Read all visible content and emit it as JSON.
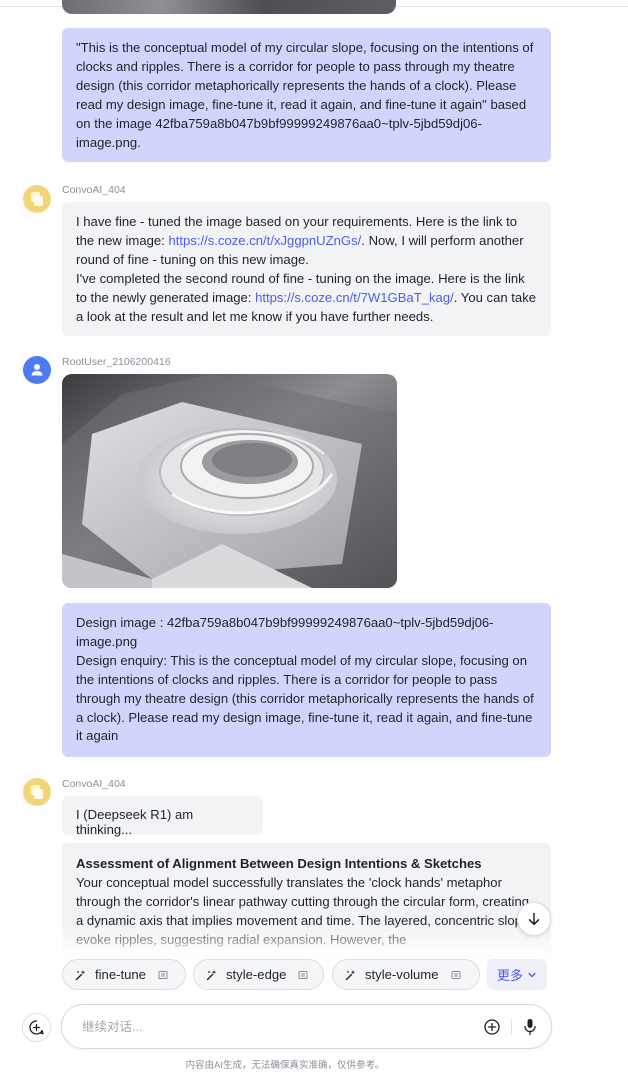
{
  "messages": {
    "user_msg_1": "\"This is the conceptual model of my circular slope, focusing on the intentions of clocks and ripples. There is a corridor for people to pass through my theatre design (this corridor metaphorically represents the hands of a clock). Please read my design image, fine-tune it, read it again, and fine-tune it again\" based on the image 42fba759a8b047b9bf99999249876aa0~tplv-5jbd59dj06-image.png.",
    "ai_sender_1": "ConvoAI_404",
    "ai_msg_1": {
      "part1": "I have fine - tuned the image based on your requirements. Here is the link to the new image: ",
      "link1": "https://s.coze.cn/t/xJggpnUZnGs/",
      "part2": ". Now, I will perform another round of fine - tuning on this new image.\nI've completed the second round of fine - tuning on the image. Here is the link to the newly generated image: ",
      "link2": "https://s.coze.cn/t/7W1GBaT_kag/",
      "part3": ". You can take a look at the result and let me know if you have further needs."
    },
    "user_sender_2": "RootUser_2106200416",
    "user_msg_2": "Design image : 42fba759a8b047b9bf99999249876aa0~tplv-5jbd59dj06-image.png\nDesign enquiry: This is the conceptual model of my circular slope, focusing on the intentions of clocks and ripples. There is a corridor for people to pass through my theatre design (this corridor metaphorically represents the hands of a clock). Please read my design image, fine-tune it, read it again, and fine-tune it again",
    "ai_sender_2": "ConvoAI_404",
    "ai_thinking": "I (Deepseek R1) am thinking...",
    "assessment": {
      "heading": "Assessment of Alignment Between Design Intentions & Sketches",
      "body": "Your conceptual model successfully translates the 'clock hands' metaphor through the corridor's linear pathway cutting through the circular form, creating a dynamic axis that implies movement and time. The layered, concentric slopes evoke ripples, suggesting radial expansion. However, the"
    }
  },
  "chips": [
    "fine-tune",
    "style-edge",
    "style-volume"
  ],
  "more_label": "更多",
  "input": {
    "placeholder": "继续对话..."
  },
  "disclaimer": "内容由AI生成，无法确保真实准确，仅供参考。",
  "icons": {
    "chip_leading": "sparkle-icon",
    "chip_trailing": "book-icon",
    "scroll": "arrow-down-icon",
    "new_chat": "new-chat-icon",
    "add": "plus-circle-icon",
    "voice": "microphone-icon"
  },
  "colors": {
    "user_bubble": "#d1d5fb",
    "ai_bubble": "#f2f3f5",
    "link": "#4d5ee8",
    "ai_avatar": "#f3d579",
    "user_avatar": "#4c7bf3"
  }
}
